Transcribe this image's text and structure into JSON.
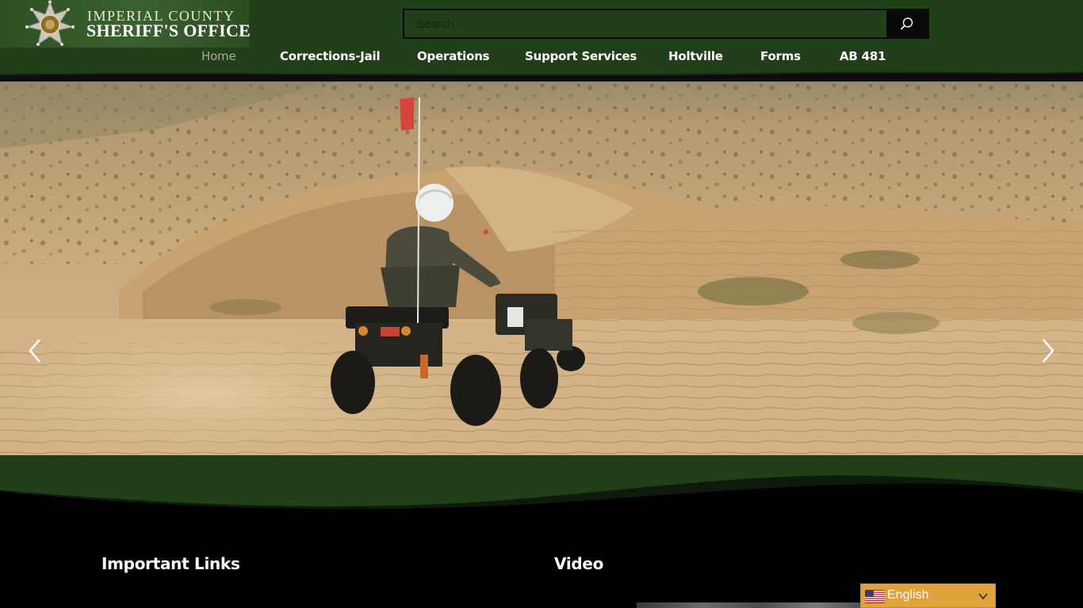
{
  "header": {
    "logo_line1": "IMPERIAL COUNTY",
    "logo_line2": "SHERIFF'S OFFICE",
    "search_placeholder": "Search...",
    "search_icon": "search-icon"
  },
  "nav": {
    "items": [
      {
        "label": "Home",
        "active": true
      },
      {
        "label": "Corrections-Jail",
        "active": false
      },
      {
        "label": "Operations",
        "active": false
      },
      {
        "label": "Support Services",
        "active": false
      },
      {
        "label": "Holtville",
        "active": false
      },
      {
        "label": "Forms",
        "active": false
      },
      {
        "label": "AB 481",
        "active": false
      }
    ]
  },
  "slider": {
    "slide_count": 4,
    "active_slide": 2,
    "prev_icon": "chevron-left-icon",
    "next_icon": "chevron-right-icon"
  },
  "footer": {
    "important_links_heading": "Important Links",
    "video_heading": "Video"
  },
  "language": {
    "selected": "English",
    "flag_icon": "us-flag-icon",
    "chevron_icon": "chevron-down-icon"
  },
  "colors": {
    "header_green": "#213f18",
    "nav_active": "#a6a89c",
    "language_button": "#e0a33b",
    "footer_background": "#000000"
  }
}
